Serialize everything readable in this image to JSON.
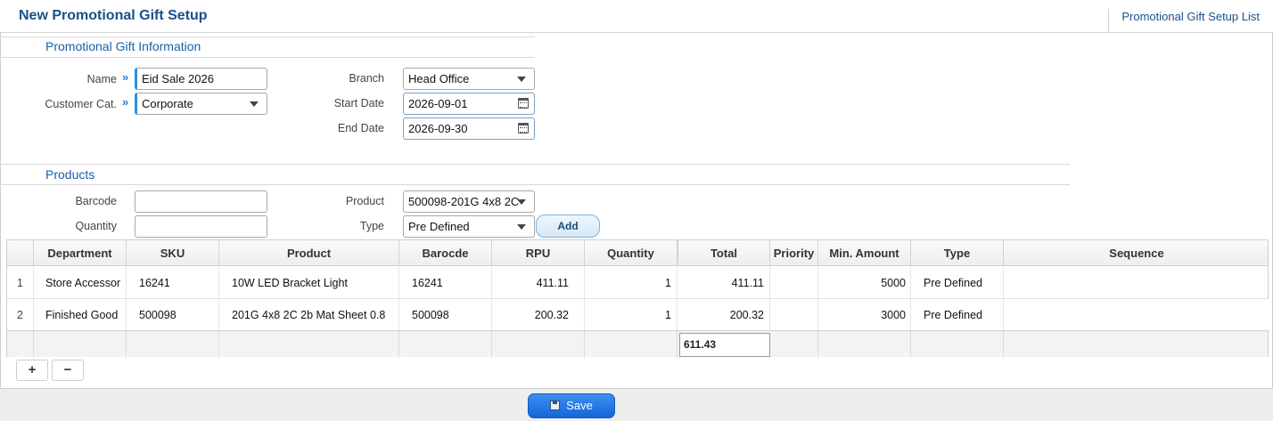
{
  "header": {
    "title": "New Promotional Gift Setup",
    "list_link": "Promotional Gift Setup List"
  },
  "info_section": {
    "title": "Promotional Gift Information",
    "name_label": "Name",
    "name_value": "Eid Sale 2026",
    "customer_cat_label": "Customer Cat.",
    "customer_cat_value": "Corporate",
    "branch_label": "Branch",
    "branch_value": "Head Office",
    "start_date_label": "Start Date",
    "start_date_value": "2026-09-01",
    "end_date_label": "End Date",
    "end_date_value": "2026-09-30",
    "required_marker": "»"
  },
  "products_section": {
    "title": "Products",
    "barcode_label": "Barcode",
    "barcode_value": "",
    "quantity_label": "Quantity",
    "quantity_value": "",
    "product_label": "Product",
    "product_value": "500098-201G 4x8 2C",
    "type_label": "Type",
    "type_value": "Pre Defined",
    "add_label": "Add"
  },
  "table": {
    "columns": [
      "Department",
      "SKU",
      "Product",
      "Barocde",
      "RPU",
      "Quantity",
      "Total",
      "Priority",
      "Min. Amount",
      "Type",
      "Sequence"
    ],
    "rows": [
      {
        "index": "1",
        "department": "Store Accessor",
        "sku": "16241",
        "product": "10W LED Bracket Light",
        "barcode": "16241",
        "rpu": "411.11",
        "quantity": "1",
        "total": "411.11",
        "priority": "",
        "min_amount": "5000",
        "type": "Pre Defined",
        "sequence": ""
      },
      {
        "index": "2",
        "department": "Finished Good",
        "sku": "500098",
        "product": "201G 4x8 2C 2b Mat Sheet 0.8",
        "barcode": "500098",
        "rpu": "200.32",
        "quantity": "1",
        "total": "200.32",
        "priority": "",
        "min_amount": "3000",
        "type": "Pre Defined",
        "sequence": ""
      }
    ],
    "grand_total": "611.43",
    "add_row_label": "+",
    "remove_row_label": "−"
  },
  "footer": {
    "save_label": "Save"
  },
  "colors": {
    "title_blue": "#1b4f8a",
    "section_blue": "#1c5fa8",
    "save_button": "#1a6ee0",
    "required_accent": "#2a8fe0"
  }
}
